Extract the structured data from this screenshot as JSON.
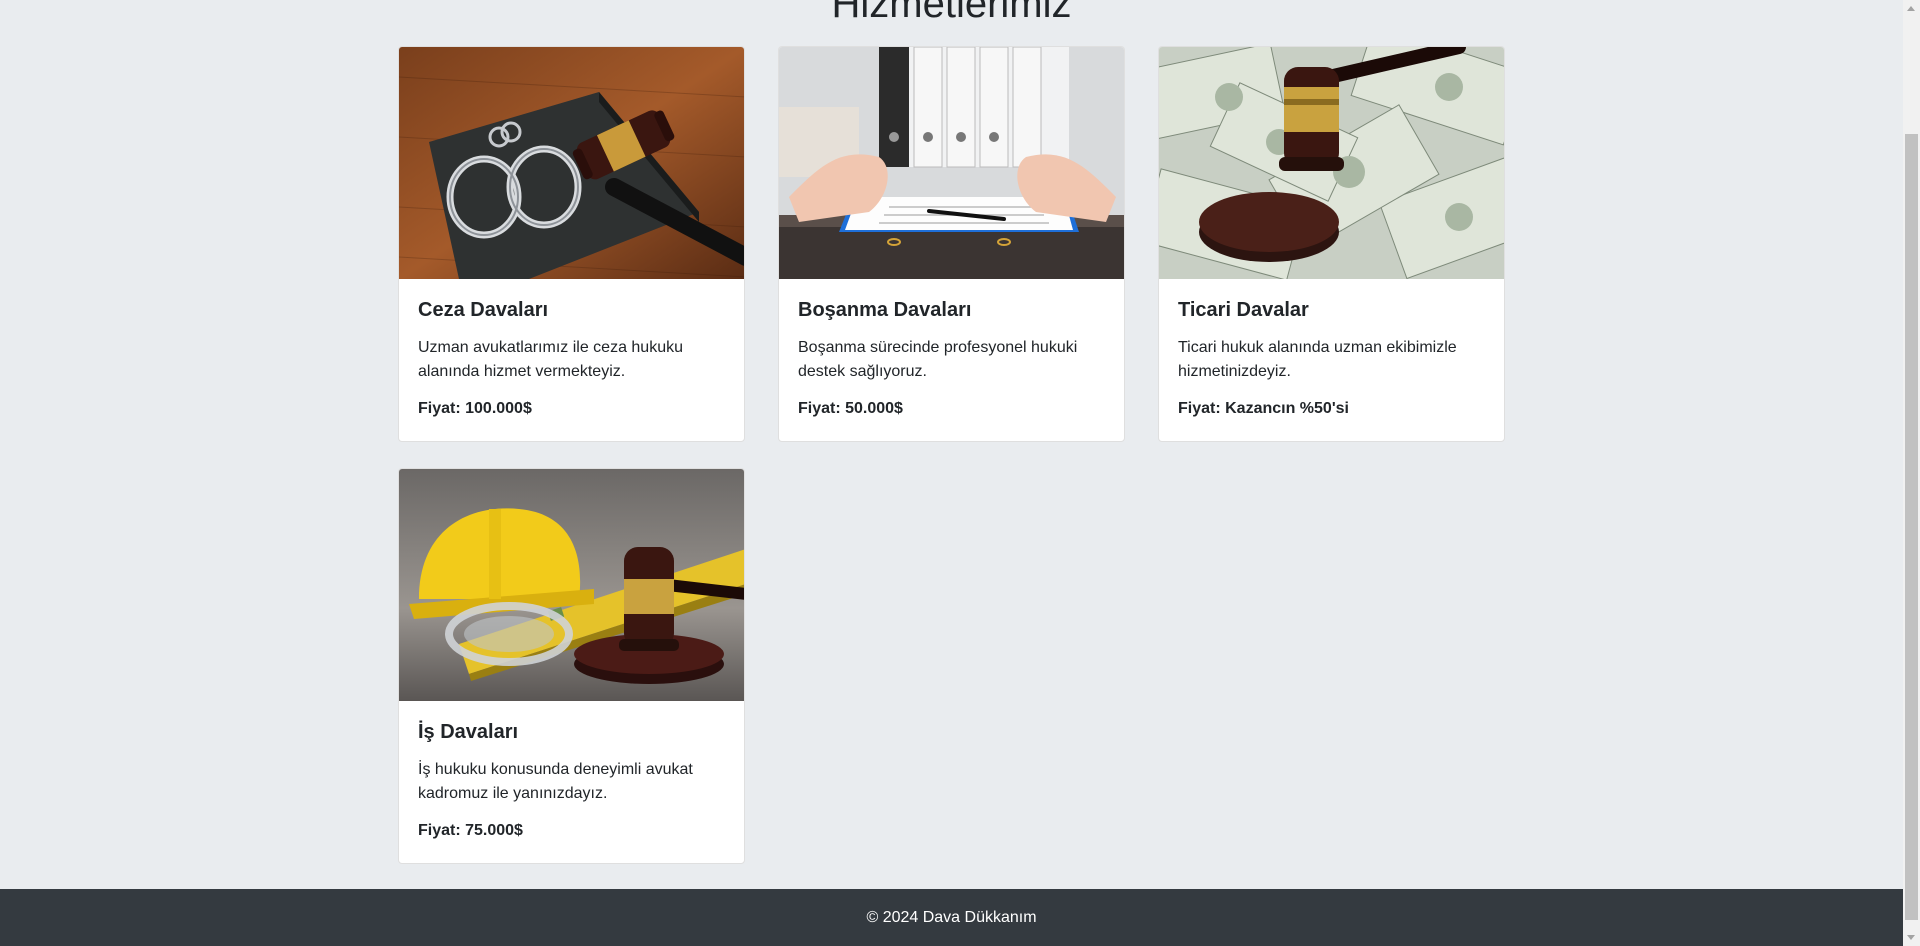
{
  "section": {
    "title": "Hizmetlerimiz"
  },
  "services": [
    {
      "title": "Ceza Davaları",
      "description": "Uzman avukatlarımız ile ceza hukuku alanında hizmet vermekteyiz.",
      "price": "Fiyat: 100.000$",
      "image_icon": "handcuffs-gavel-image"
    },
    {
      "title": "Boşanma Davaları",
      "description": "Boşanma sürecinde profesyonel hukuki destek sağlıyoruz.",
      "price": "Fiyat: 50.000$",
      "image_icon": "divorce-hands-image"
    },
    {
      "title": "Ticari Davalar",
      "description": "Ticari hukuk alanında uzman ekibimizle hizmetinizdeyiz.",
      "price": "Fiyat: Kazancın %50'si",
      "image_icon": "money-gavel-image"
    },
    {
      "title": "İş Davaları",
      "description": "İş hukuku konusunda deneyimli avukat kadromuz ile yanınızdayız.",
      "price": "Fiyat: 75.000$",
      "image_icon": "hardhat-gavel-image"
    }
  ],
  "footer": {
    "text": "© 2024 Dava Dükkanım"
  },
  "colors": {
    "background": "#e9ecef",
    "footer": "#343a40",
    "card": "#ffffff"
  }
}
